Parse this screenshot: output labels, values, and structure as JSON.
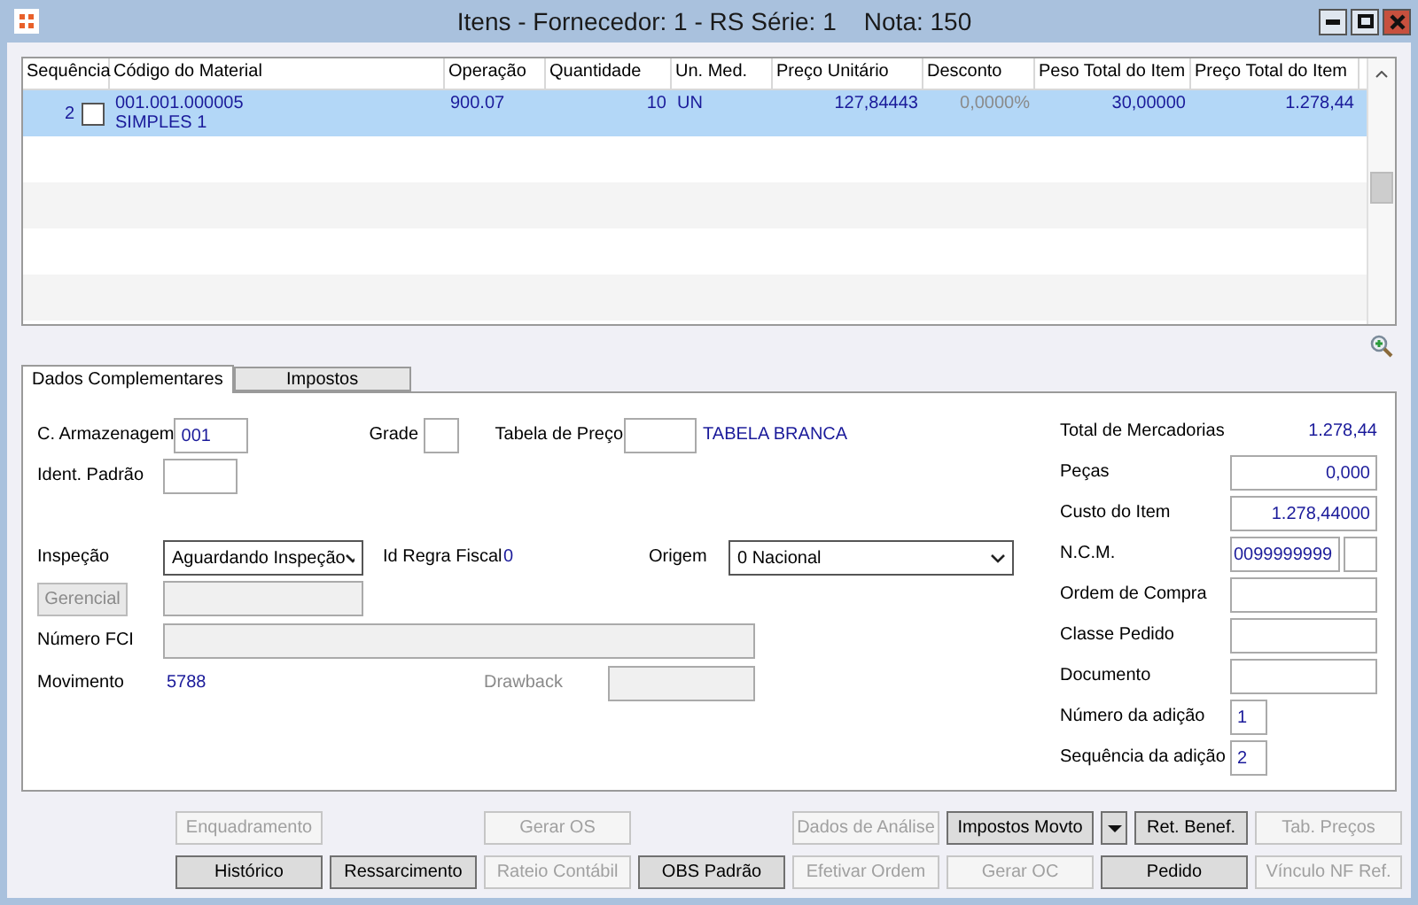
{
  "window": {
    "title": "Itens - Fornecedor: 1 - RS Série: 1    Nota: 150"
  },
  "table": {
    "columns": [
      "Sequência",
      "Código do Material",
      "Operação",
      "Quantidade",
      "Un. Med.",
      "Preço Unitário",
      "Desconto",
      "Peso Total do Item",
      "Preço Total do Item"
    ],
    "rows": [
      {
        "selected": true,
        "checked": false,
        "sequencia": "2",
        "codigo": "001.001.000005",
        "descricao": "SIMPLES 1",
        "operacao": "900.07",
        "quantidade": "10",
        "unidade": "UN",
        "preco_unitario": "127,84443",
        "desconto": "0,0000%",
        "peso_total": "30,00000",
        "preco_total": "1.278,44"
      }
    ]
  },
  "tabs": [
    {
      "label": "Dados Complementares",
      "selected": true
    },
    {
      "label": "Impostos",
      "selected": false
    }
  ],
  "form": {
    "armazenagem": {
      "label": "C. Armazenagem",
      "value": "001"
    },
    "grade": {
      "label": "Grade"
    },
    "tabela_preco": {
      "label": "Tabela de Preço",
      "description": "TABELA BRANCA"
    },
    "ident_padrao": {
      "label": "Ident. Padrão"
    },
    "inspecao": {
      "label": "Inspeção",
      "value": "Aguardando Inspeção"
    },
    "regra_fiscal": {
      "label": "Id Regra Fiscal",
      "value": "0"
    },
    "origem": {
      "label": "Origem",
      "value": "0 Nacional"
    },
    "gerencial": {
      "label": "Gerencial",
      "disabled": true
    },
    "numero_fci": {
      "label": "Número FCI"
    },
    "movimento": {
      "label": "Movimento",
      "value": "5788"
    },
    "drawback": {
      "label": "Drawback",
      "disabled": true
    }
  },
  "summary": [
    {
      "label": "Total de Mercadorias",
      "kind": "text",
      "value": "1.278,44"
    },
    {
      "label": "Peças",
      "kind": "number",
      "value": "0,000"
    },
    {
      "label": "Custo do Item",
      "kind": "number",
      "value": "1.278,44000"
    },
    {
      "label": "N.C.M.",
      "kind": "code",
      "value": "0099999999"
    },
    {
      "label": "Ordem de Compra",
      "kind": "blank"
    },
    {
      "label": "Classe Pedido",
      "kind": "blank"
    },
    {
      "label": "Documento",
      "kind": "blank"
    },
    {
      "label": "Número da adição",
      "kind": "small",
      "value": "1"
    },
    {
      "label": "Sequência da adição",
      "kind": "small",
      "value": "2"
    }
  ],
  "buttons_top": [
    {
      "label": "Enquadramento",
      "disabled": true
    },
    {
      "label": "Gerar OS",
      "disabled": true
    },
    {
      "label": "Dados de Análise",
      "disabled": true
    },
    {
      "label": "Impostos Movto",
      "disabled": false
    },
    {
      "label": "Ret. Benef.",
      "disabled": false
    },
    {
      "label": "Tab. Preços",
      "disabled": true
    }
  ],
  "buttons_bottom": [
    {
      "label": "Histórico",
      "disabled": false
    },
    {
      "label": "Ressarcimento",
      "disabled": false
    },
    {
      "label": "Rateio Contábil",
      "disabled": true
    },
    {
      "label": "OBS Padrão",
      "disabled": false
    },
    {
      "label": "Efetivar Ordem",
      "disabled": true
    },
    {
      "label": "Gerar OC",
      "disabled": true
    },
    {
      "label": "Pedido",
      "disabled": false
    },
    {
      "label": "Vínculo NF Ref.",
      "disabled": true
    }
  ]
}
